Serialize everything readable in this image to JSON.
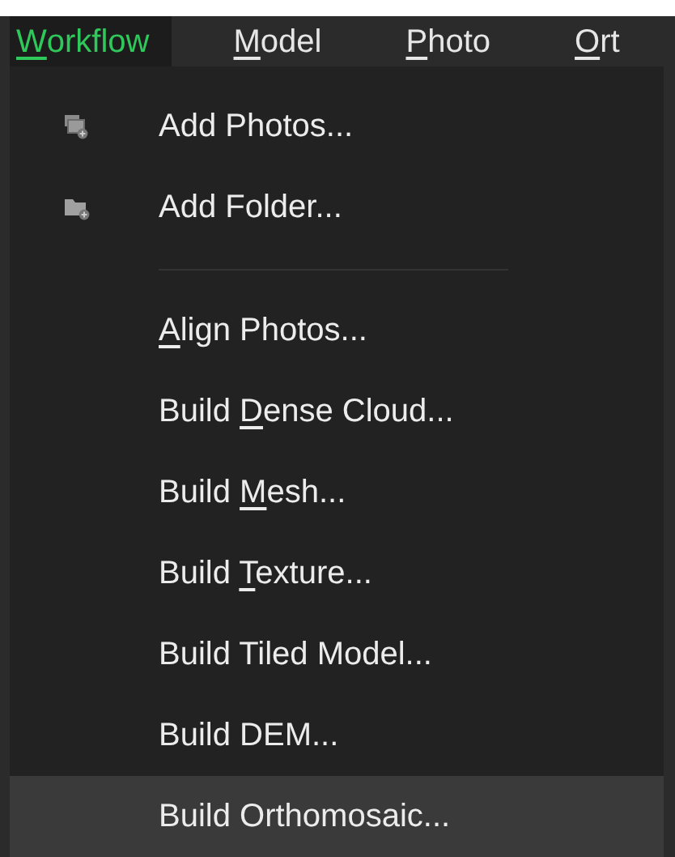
{
  "menu_bar": [
    {
      "key": "W",
      "after": "orkflow",
      "selected": true
    },
    {
      "key": "M",
      "after": "odel",
      "selected": false
    },
    {
      "key": "P",
      "after": "hoto",
      "selected": false
    },
    {
      "key": "O",
      "after": "rt",
      "selected": false
    }
  ],
  "menu": [
    {
      "kind": "photos",
      "label": "Add Photos...",
      "highlighted": false
    },
    {
      "kind": "folder",
      "label": "Add Folder...",
      "highlighted": false
    },
    {
      "kind": "separator"
    },
    {
      "kind": "item",
      "key": "A",
      "after": "lign Photos...",
      "highlighted": false
    },
    {
      "kind": "item",
      "before": "Build ",
      "key": "D",
      "after": "ense Cloud...",
      "highlighted": false
    },
    {
      "kind": "item",
      "before": "Build ",
      "key": "M",
      "after": "esh...",
      "highlighted": false
    },
    {
      "kind": "item",
      "before": "Build ",
      "key": "T",
      "after": "exture...",
      "highlighted": false
    },
    {
      "kind": "item",
      "label": "Build Tiled Model...",
      "highlighted": false
    },
    {
      "kind": "item",
      "label": "Build DEM...",
      "highlighted": false
    },
    {
      "kind": "item",
      "label": "Build Orthomosaic...",
      "highlighted": true
    }
  ]
}
